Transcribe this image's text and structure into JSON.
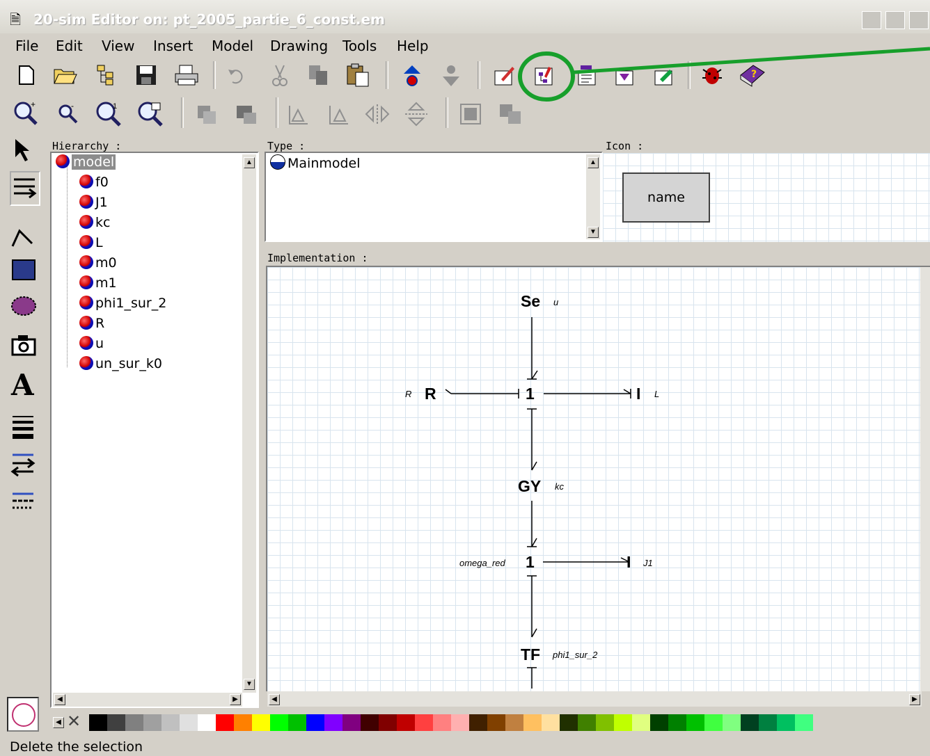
{
  "window": {
    "title": "20-sim Editor on: pt_2005_partie_6_const.em"
  },
  "menu": [
    "File",
    "Edit",
    "View",
    "Insert",
    "Model",
    "Drawing",
    "Tools",
    "Help"
  ],
  "panels": {
    "hierarchy_label": "Hierarchy :",
    "type_label": "Type :",
    "icon_label": "Icon :",
    "implementation_label": "Implementation :"
  },
  "hierarchy": {
    "root": "model",
    "children": [
      "f0",
      "J1",
      "kc",
      "L",
      "m0",
      "m1",
      "phi1_sur_2",
      "R",
      "u",
      "un_sur_k0"
    ]
  },
  "type_panel": {
    "value": "Mainmodel"
  },
  "icon_panel": {
    "name": "name"
  },
  "diagram": {
    "se": {
      "label": "Se",
      "param": "u"
    },
    "one_top": {
      "label": "1"
    },
    "r": {
      "label": "R",
      "param": "R"
    },
    "l": {
      "label": "I",
      "param": "L"
    },
    "gy": {
      "label": "GY",
      "param": "kc"
    },
    "one_bottom": {
      "label": "1",
      "param": "omega_red"
    },
    "j1": {
      "label": "I",
      "param": "J1"
    },
    "tf": {
      "label": "TF",
      "param": "phi1_sur_2"
    }
  },
  "status": {
    "text": "Delete the selection"
  },
  "palette": [
    "#000000",
    "#404040",
    "#808080",
    "#a0a0a0",
    "#c0c0c0",
    "#e0e0e0",
    "#ffffff",
    "#ff0000",
    "#ff8000",
    "#ffff00",
    "#00ff00",
    "#00c000",
    "#0000ff",
    "#8000ff",
    "#800080",
    "#400000",
    "#800000",
    "#c00000",
    "#ff4040",
    "#ff8080",
    "#ffb0b0",
    "#402000",
    "#804000",
    "#c08040",
    "#ffc060",
    "#ffe0a0",
    "#203000",
    "#408000",
    "#80c000",
    "#c0ff00",
    "#e0ff80",
    "#004000",
    "#008000",
    "#00c000",
    "#40ff40",
    "#80ff80",
    "#004020",
    "#008040",
    "#00c060",
    "#40ff80"
  ],
  "colors": {
    "callout_green": "#179f2b",
    "tree_selected_bg": "#8c8c8c"
  }
}
